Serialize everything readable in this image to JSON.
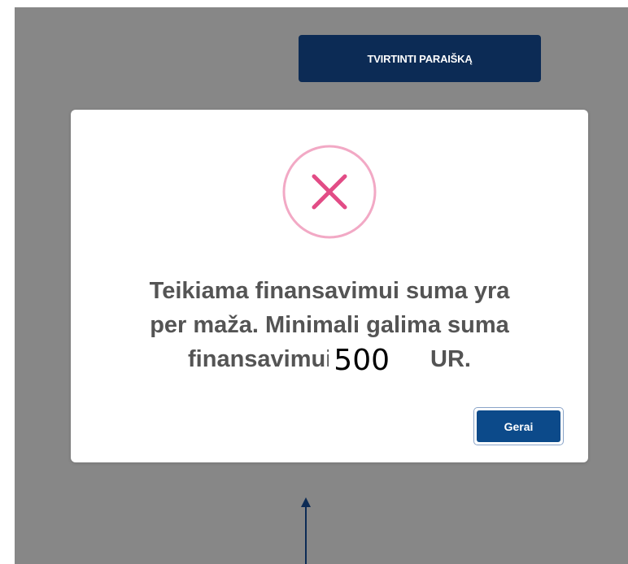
{
  "page": {
    "confirm_button_label": "TVIRTINTI PARAIŠKĄ"
  },
  "dialog": {
    "icon": "error-x-circle-icon",
    "message_line_1": "Teikiama finansavimui suma yra",
    "message_line_2": "per maža. Minimali galima suma",
    "message_line_3_start": "finansavimui",
    "message_amount": "500",
    "message_line_3_end": "UR.",
    "ok_button_label": "Gerai"
  },
  "colors": {
    "overlay": "#878787",
    "primary_button": "#0c2b55",
    "ok_button": "#0c4a8a",
    "error_accent": "#e85b8f",
    "message_text": "#545454",
    "annotation_arrow": "#0c2b55"
  }
}
